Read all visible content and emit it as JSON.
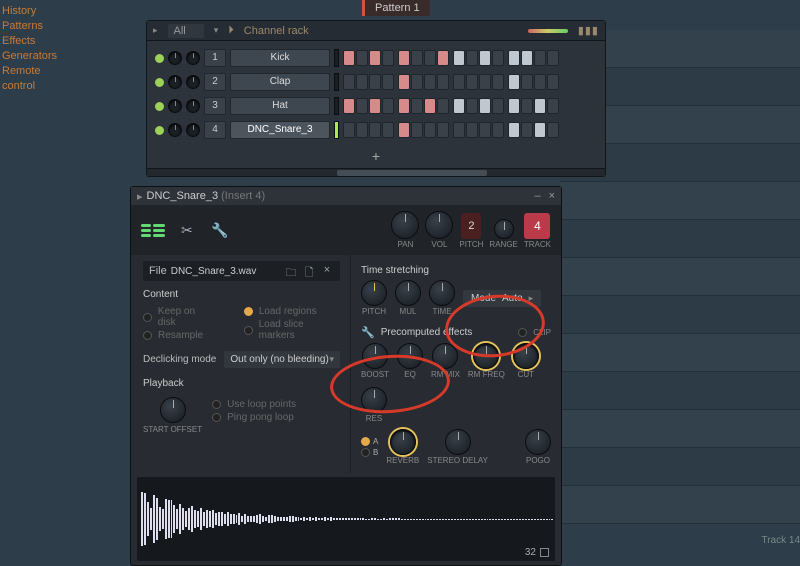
{
  "nav": [
    "History",
    "Patterns",
    "Effects",
    "Generators",
    "Remote control"
  ],
  "pattern_tab": "Pattern 1",
  "rack": {
    "all": "All",
    "title": "Channel rack",
    "channels": [
      {
        "num": "1",
        "name": "Kick"
      },
      {
        "num": "2",
        "name": "Clap"
      },
      {
        "num": "3",
        "name": "Hat"
      },
      {
        "num": "4",
        "name": "DNC_Snare_3"
      }
    ]
  },
  "sampler": {
    "title": "DNC_Snare_3",
    "insert": "(Insert 4)",
    "file_label": "File",
    "file_name": "DNC_Snare_3.wav",
    "top_knobs": {
      "pan": "PAN",
      "vol": "VOL",
      "pitch": "PITCH",
      "range": "RANGE",
      "track": "TRACK",
      "pitch_n": "2",
      "track_n": "4"
    },
    "content": {
      "title": "Content",
      "keep": "Keep on disk",
      "load_regions": "Load regions",
      "resample": "Resample",
      "load_slices": "Load slice markers"
    },
    "declick": {
      "label": "Declicking mode",
      "value": "Out only (no bleeding)"
    },
    "playback": {
      "title": "Playback",
      "start": "START OFFSET",
      "use_loop": "Use loop points",
      "ping": "Ping pong loop"
    },
    "ts": {
      "title": "Time stretching",
      "pitch": "PITCH",
      "mul": "MUL",
      "time": "TIME",
      "mode_l": "Mode",
      "mode_v": "Auto"
    },
    "pe": {
      "title": "Precomputed effects",
      "clip": "CLIP",
      "boost": "BOOST",
      "eq": "EQ",
      "rmmix": "RM MIX",
      "rmfreq": "RM FREQ",
      "cut": "CUT",
      "res": "RES",
      "a": "A",
      "b": "B",
      "reverb": "REVERB",
      "sdelay": "STEREO DELAY",
      "pogo": "POGO"
    },
    "wf_footer": "32"
  },
  "pl_track": "Track 14"
}
